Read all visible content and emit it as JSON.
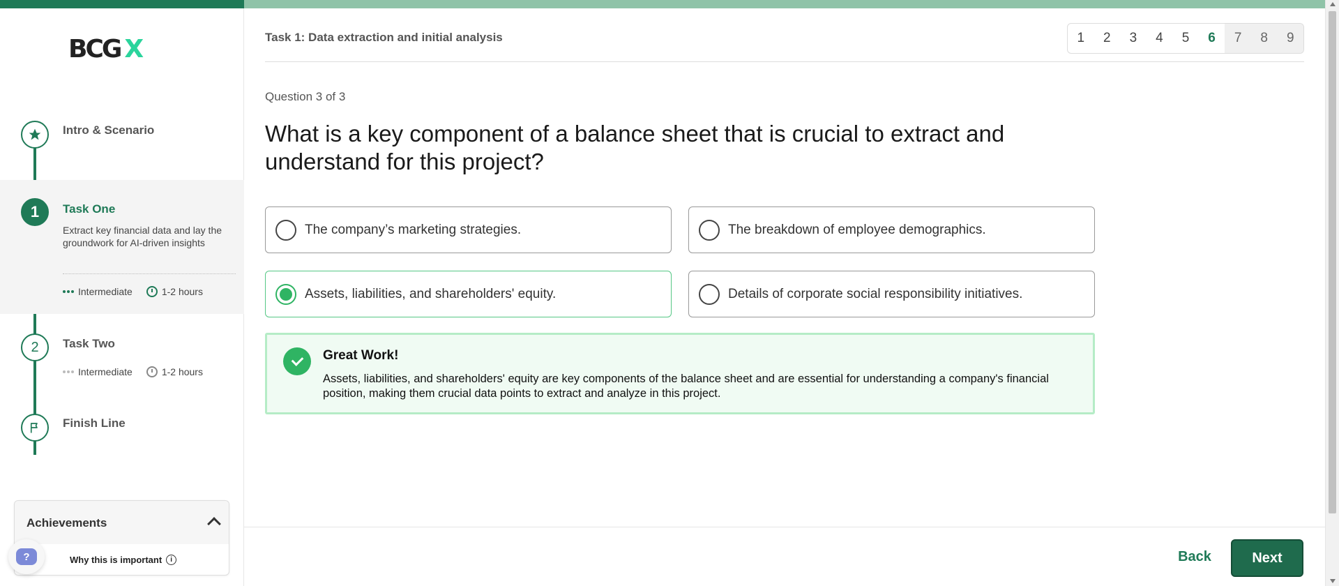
{
  "brand": {
    "logo_main": "BCG",
    "logo_accent": "X",
    "accent_color": "#1f7a57",
    "check_color": "#2fb463"
  },
  "sidebar": {
    "steps": [
      {
        "number": "",
        "icon": "star-icon",
        "title": "Intro & Scenario"
      },
      {
        "number": "1",
        "title": "Task One",
        "description": "Extract key financial data and lay the groundwork for AI-driven insights",
        "level": "Intermediate",
        "duration": "1-2 hours",
        "active": true
      },
      {
        "number": "2",
        "title": "Task Two",
        "level": "Intermediate",
        "duration": "1-2 hours"
      },
      {
        "number": "",
        "icon": "flag-icon",
        "title": "Finish Line"
      }
    ],
    "achievements": {
      "title": "Achievements",
      "why_label": "Why this is important",
      "info": "i",
      "help": "?"
    }
  },
  "header": {
    "task_title": "Task 1: Data extraction and initial analysis",
    "pages": [
      "1",
      "2",
      "3",
      "4",
      "5",
      "6",
      "7",
      "8",
      "9"
    ],
    "current_page": "6"
  },
  "question": {
    "count": "Question 3 of 3",
    "text": "What is a key component of a balance sheet that is crucial to extract and understand for this project?",
    "options": [
      {
        "label": "The company’s marketing strategies.",
        "selected": false
      },
      {
        "label": "The breakdown of employee demographics.",
        "selected": false
      },
      {
        "label": "Assets, liabilities, and shareholders' equity.",
        "selected": true
      },
      {
        "label": "Details of corporate social responsibility initiatives.",
        "selected": false
      }
    ]
  },
  "feedback": {
    "title": "Great Work!",
    "text": "Assets, liabilities, and shareholders' equity are key components of the balance sheet and are essential for understanding a company's financial position, making them crucial data points to extract and analyze in this project."
  },
  "footer": {
    "back_label": "Back",
    "next_label": "Next"
  }
}
